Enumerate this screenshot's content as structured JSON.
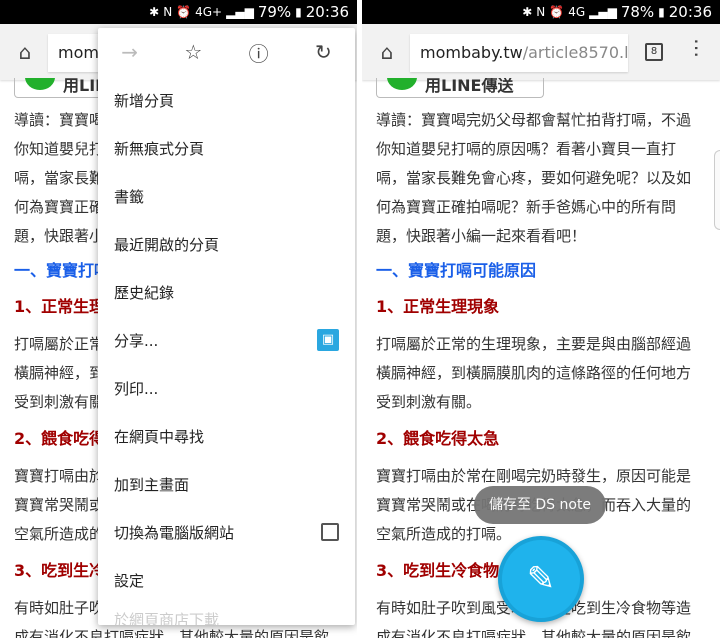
{
  "left_status": {
    "battery": "79%",
    "time": "20:36",
    "network": "4G+"
  },
  "right_status": {
    "battery": "78%",
    "time": "20:36",
    "network": "4G"
  },
  "browser": {
    "url_host": "mombaby.tw",
    "url_path": "/article8570.l",
    "tab_count": "8",
    "url_left_visible": "mom"
  },
  "line_button": "用LINE傳送",
  "article": {
    "intro": [
      "導讀：寶寶喝完奶父母都會幫忙拍背打嗝，不過",
      "你知道嬰兒打嗝的原因嗎？看著小寶貝一直打",
      "嗝，當家長難免會心疼，要如何避免呢？以及如",
      "何為寶寶正確拍嗝呢？新手爸媽心中的所有問",
      "題，快跟著小編一起來看看吧！"
    ],
    "heading": "一、寶寶打嗝可能原因",
    "sections": [
      {
        "title": "1、正常生理現象",
        "lines": [
          "打嗝屬於正常的生理現象，主要是與由腦部經過",
          "橫膈神經，到橫膈膜肌肉的這條路徑的任何地方",
          "受到刺激有關。"
        ]
      },
      {
        "title": "2、餵食吃得太急",
        "lines": [
          "寶寶打嗝由於常在剛喝完奶時發生，原因可能是",
          "寶寶常哭鬧或在喝奶時吃得太急，而吞入大量的",
          "空氣所造成的打嗝。"
        ]
      },
      {
        "title": "3、吃到生冷食物",
        "lines": [
          "有時如肚子吹到風受寒，或是吃到生冷食物等造",
          "成有消化不良打嗝症狀，其他較大量的原因是飲"
        ]
      }
    ]
  },
  "menu": {
    "items": [
      "新增分頁",
      "新無痕式分頁",
      "書籤",
      "最近開啟的分頁",
      "歷史紀錄",
      "分享...",
      "列印...",
      "在網頁中尋找",
      "加到主畫面",
      "切換為電腦版網站",
      "設定",
      "於網頁商店下載"
    ]
  },
  "toast": "儲存至 DS note",
  "colors": {
    "fab": "#1fb3ec",
    "heading_blue": "#1a5fe8",
    "heading_red": "#a00000"
  }
}
